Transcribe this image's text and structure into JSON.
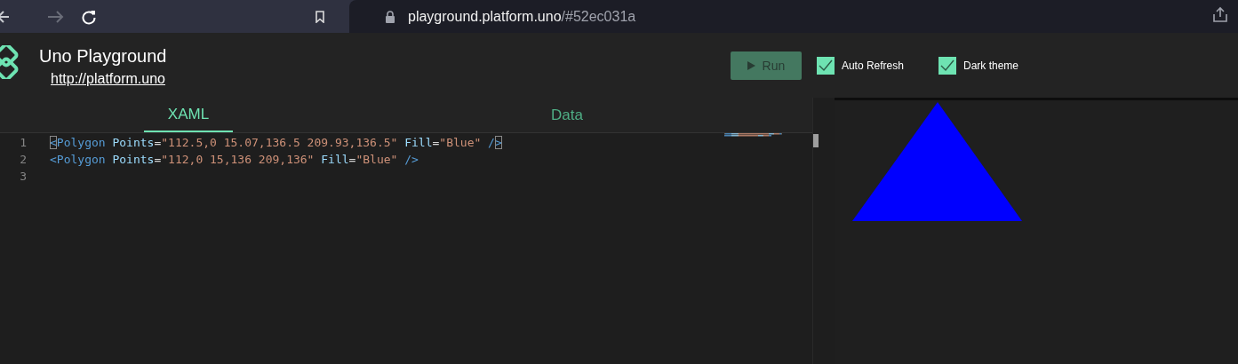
{
  "browser": {
    "url_host": "playground.platform.uno",
    "url_path": "/#52ec031a"
  },
  "app": {
    "title": "Uno Playground",
    "link": "http://platform.uno"
  },
  "toolbar": {
    "run": {
      "label": "Run",
      "disabled": true
    },
    "checkboxes": [
      {
        "label": "Auto Refresh",
        "checked": true
      },
      {
        "label": "Dark theme",
        "checked": true
      }
    ]
  },
  "tabs": [
    {
      "label": "XAML",
      "selected": true
    },
    {
      "label": "Data",
      "selected": false
    }
  ],
  "editor": {
    "lines": [
      {
        "number": "1",
        "tokens": [
          {
            "kind": "delim-matched",
            "text": "<"
          },
          {
            "kind": "tag",
            "text": "Polygon"
          },
          {
            "kind": "attr",
            "text": " Points"
          },
          {
            "kind": "eq",
            "text": "="
          },
          {
            "kind": "string",
            "text": "\"112.5,0 15.07,136.5 209.93,136.5\""
          },
          {
            "kind": "attr",
            "text": " Fill"
          },
          {
            "kind": "eq",
            "text": "="
          },
          {
            "kind": "string",
            "text": "\"Blue\""
          },
          {
            "kind": "delim",
            "text": " /"
          },
          {
            "kind": "delim-matched",
            "text": ">"
          }
        ]
      },
      {
        "number": "2",
        "tokens": [
          {
            "kind": "delim",
            "text": "<"
          },
          {
            "kind": "tag",
            "text": "Polygon"
          },
          {
            "kind": "attr",
            "text": " Points"
          },
          {
            "kind": "eq",
            "text": "="
          },
          {
            "kind": "string",
            "text": "\"112,0 15,136 209,136\""
          },
          {
            "kind": "attr",
            "text": " Fill"
          },
          {
            "kind": "eq",
            "text": "="
          },
          {
            "kind": "string",
            "text": "\"Blue\""
          },
          {
            "kind": "delim",
            "text": " />"
          }
        ]
      },
      {
        "number": "3"
      }
    ]
  },
  "preview": {
    "shape": {
      "kind": "polygon",
      "color": "#0000ff"
    }
  }
}
